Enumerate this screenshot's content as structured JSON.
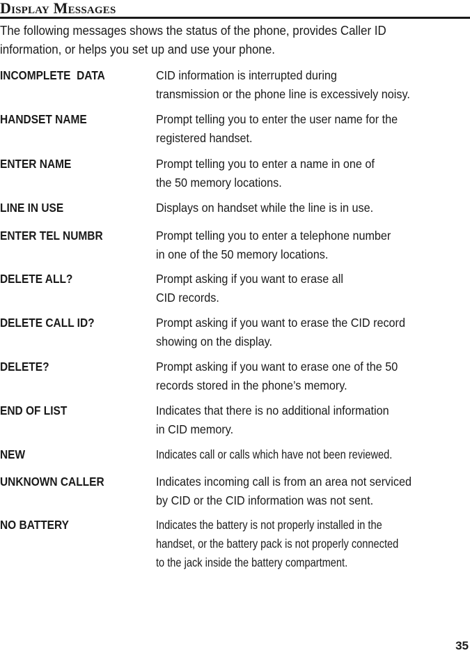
{
  "header": {
    "title": "Display Messages"
  },
  "intro": {
    "lines": [
      "The following messages shows the status of the phone, provides Caller ID",
      "information, or helps you set up and use your phone."
    ]
  },
  "messages": [
    {
      "term": "INCOMPLETE  DATA",
      "description_lines": [
        "CID information is interrupted during",
        "transmission or the phone line is excessively noisy."
      ]
    },
    {
      "term": "HANDSET NAME",
      "description_lines": [
        "Prompt telling you to enter the user name for the",
        "registered handset."
      ]
    },
    {
      "term": "ENTER NAME",
      "description_lines": [
        "Prompt telling you to enter a name in one of",
        "the 50 memory locations."
      ]
    },
    {
      "term": "LINE IN USE",
      "description_lines": [
        "Displays on handset while the line is in use."
      ]
    },
    {
      "term": "ENTER TEL NUMBR",
      "description_lines": [
        "Prompt telling you to enter a telephone number",
        "in one of the 50 memory locations."
      ]
    },
    {
      "term": "DELETE ALL?",
      "description_lines": [
        "Prompt asking if you want to erase all",
        "CID records."
      ]
    },
    {
      "term": "DELETE CALL ID?",
      "description_lines": [
        "Prompt asking if you want to erase the CID record",
        "showing on the display."
      ]
    },
    {
      "term": "DELETE?",
      "description_lines": [
        "Prompt asking if you want to erase one of the 50",
        "records stored in the phone’s memory."
      ]
    },
    {
      "term": "END OF LIST",
      "description_lines": [
        "Indicates that there is no additional information",
        "in CID memory."
      ]
    },
    {
      "term": "NEW",
      "description_lines": [
        "Indicates call or calls which have not been reviewed."
      ]
    },
    {
      "term": "UNKNOWN CALLER",
      "description_lines": [
        "Indicates incoming call is from an area not serviced",
        "by CID or the CID information was not sent."
      ]
    },
    {
      "term": "NO BATTERY",
      "description_lines": [
        "Indicates the battery is not properly installed in the",
        "handset, or the battery pack is not properly connected",
        "to the jack inside the battery compartment."
      ]
    }
  ],
  "footer": {
    "page_number": "35"
  }
}
